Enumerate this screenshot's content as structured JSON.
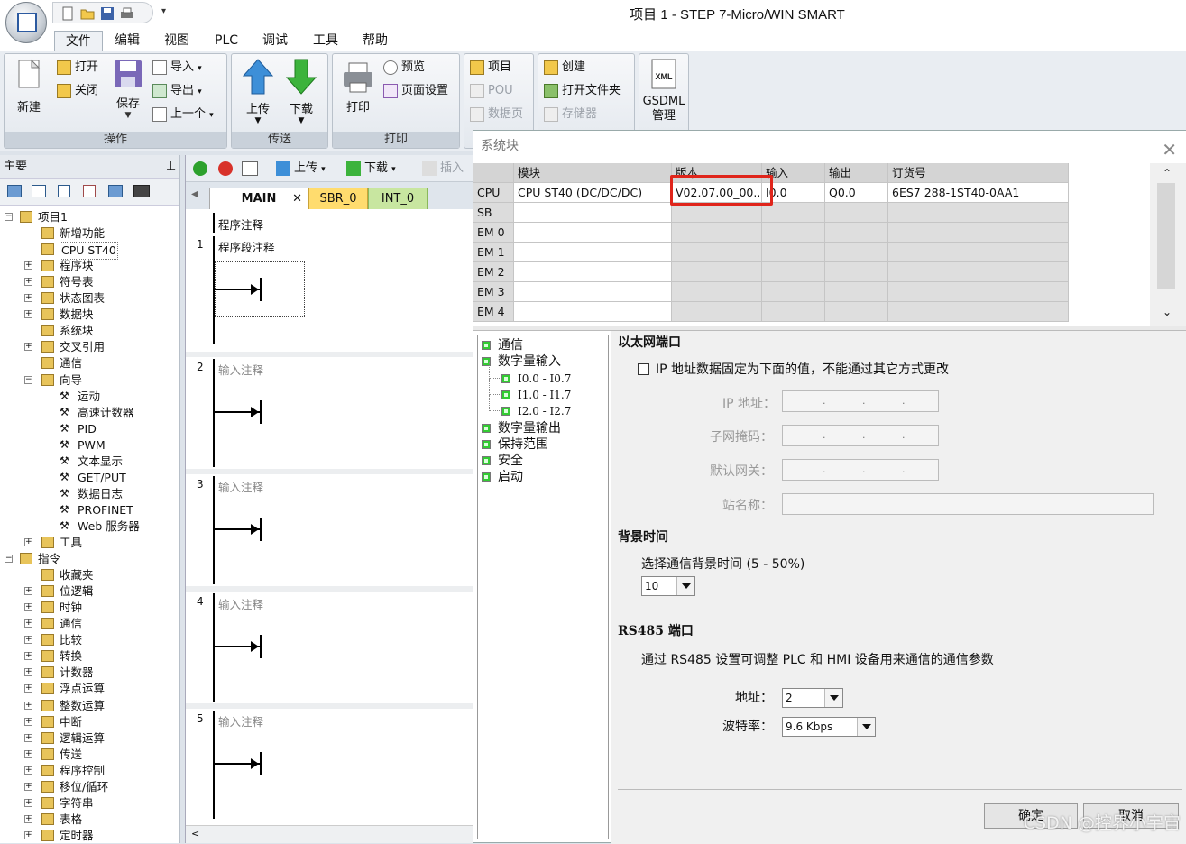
{
  "window": {
    "title": "项目 1 - STEP 7-Micro/WIN SMART"
  },
  "menu_tabs": [
    "文件",
    "编辑",
    "视图",
    "PLC",
    "调试",
    "工具",
    "帮助"
  ],
  "ribbon": {
    "groups": {
      "operate": "操作",
      "transfer": "传送",
      "print": "打印"
    },
    "new": "新建",
    "open": "打开",
    "close": "关闭",
    "save": "保存",
    "import": "导入",
    "export": "导出",
    "prev": "上一个",
    "upload": "上传",
    "download": "下载",
    "print": "打印",
    "preview": "预览",
    "page_setup": "页面设置",
    "project": "项目",
    "pou": "POU",
    "datapage": "数据页",
    "create": "创建",
    "open_folder": "打开文件夹",
    "memory": "存储器",
    "gsdml": "GSDML",
    "gsdml_manage": "管理"
  },
  "left_panel": {
    "title": "主要",
    "tree": [
      {
        "label": "项目1",
        "level": 0,
        "expander": "-"
      },
      {
        "label": "新增功能",
        "level": 1,
        "expander": ""
      },
      {
        "label": "CPU ST40",
        "level": 1,
        "expander": ""
      },
      {
        "label": "程序块",
        "level": 1,
        "expander": "+"
      },
      {
        "label": "符号表",
        "level": 1,
        "expander": "+"
      },
      {
        "label": "状态图表",
        "level": 1,
        "expander": "+"
      },
      {
        "label": "数据块",
        "level": 1,
        "expander": "+"
      },
      {
        "label": "系统块",
        "level": 1,
        "expander": ""
      },
      {
        "label": "交叉引用",
        "level": 1,
        "expander": "+"
      },
      {
        "label": "通信",
        "level": 1,
        "expander": ""
      },
      {
        "label": "向导",
        "level": 1,
        "expander": "-"
      },
      {
        "label": "运动",
        "level": 2,
        "expander": ""
      },
      {
        "label": "高速计数器",
        "level": 2,
        "expander": ""
      },
      {
        "label": "PID",
        "level": 2,
        "expander": ""
      },
      {
        "label": "PWM",
        "level": 2,
        "expander": ""
      },
      {
        "label": "文本显示",
        "level": 2,
        "expander": ""
      },
      {
        "label": "GET/PUT",
        "level": 2,
        "expander": ""
      },
      {
        "label": "数据日志",
        "level": 2,
        "expander": ""
      },
      {
        "label": "PROFINET",
        "level": 2,
        "expander": ""
      },
      {
        "label": "Web 服务器",
        "level": 2,
        "expander": ""
      },
      {
        "label": "工具",
        "level": 1,
        "expander": "+"
      },
      {
        "label": "指令",
        "level": 0,
        "expander": "-"
      },
      {
        "label": "收藏夹",
        "level": 1,
        "expander": ""
      },
      {
        "label": "位逻辑",
        "level": 1,
        "expander": "+"
      },
      {
        "label": "时钟",
        "level": 1,
        "expander": "+"
      },
      {
        "label": "通信",
        "level": 1,
        "expander": "+"
      },
      {
        "label": "比较",
        "level": 1,
        "expander": "+"
      },
      {
        "label": "转换",
        "level": 1,
        "expander": "+"
      },
      {
        "label": "计数器",
        "level": 1,
        "expander": "+"
      },
      {
        "label": "浮点运算",
        "level": 1,
        "expander": "+"
      },
      {
        "label": "整数运算",
        "level": 1,
        "expander": "+"
      },
      {
        "label": "中断",
        "level": 1,
        "expander": "+"
      },
      {
        "label": "逻辑运算",
        "level": 1,
        "expander": "+"
      },
      {
        "label": "传送",
        "level": 1,
        "expander": "+"
      },
      {
        "label": "程序控制",
        "level": 1,
        "expander": "+"
      },
      {
        "label": "移位/循环",
        "level": 1,
        "expander": "+"
      },
      {
        "label": "字符串",
        "level": 1,
        "expander": "+"
      },
      {
        "label": "表格",
        "level": 1,
        "expander": "+"
      },
      {
        "label": "定时器",
        "level": 1,
        "expander": "+"
      }
    ]
  },
  "editor": {
    "toolbar": {
      "upload": "上传",
      "download": "下载",
      "insert": "插入"
    },
    "tabs": [
      "MAIN",
      "SBR_0",
      "INT_0"
    ],
    "program_comment": "程序注释",
    "networks": [
      {
        "num": "1",
        "comment": "程序段注释"
      },
      {
        "num": "2",
        "comment": "输入注释"
      },
      {
        "num": "3",
        "comment": "输入注释"
      },
      {
        "num": "4",
        "comment": "输入注释"
      },
      {
        "num": "5",
        "comment": "输入注释"
      }
    ]
  },
  "dialog": {
    "title": "系统块",
    "grid_headers": [
      "",
      "模块",
      "版本",
      "输入",
      "输出",
      "订货号"
    ],
    "rows": [
      {
        "slot": "CPU",
        "module": "CPU ST40 (DC/DC/DC)",
        "version": "V02.07.00_00....",
        "input": "I0.0",
        "output": "Q0.0",
        "order": "6ES7 288-1ST40-0AA1"
      },
      {
        "slot": "SB",
        "module": "",
        "version": "",
        "input": "",
        "output": "",
        "order": ""
      },
      {
        "slot": "EM 0",
        "module": "",
        "version": "",
        "input": "",
        "output": "",
        "order": ""
      },
      {
        "slot": "EM 1",
        "module": "",
        "version": "",
        "input": "",
        "output": "",
        "order": ""
      },
      {
        "slot": "EM 2",
        "module": "",
        "version": "",
        "input": "",
        "output": "",
        "order": ""
      },
      {
        "slot": "EM 3",
        "module": "",
        "version": "",
        "input": "",
        "output": "",
        "order": ""
      },
      {
        "slot": "EM 4",
        "module": "",
        "version": "",
        "input": "",
        "output": "",
        "order": ""
      }
    ],
    "nav": [
      {
        "label": "通信",
        "level": 0
      },
      {
        "label": "数字量输入",
        "level": 0
      },
      {
        "label": "I0.0 - I0.7",
        "level": 1
      },
      {
        "label": "I1.0 - I1.7",
        "level": 1
      },
      {
        "label": "I2.0 - I2.7",
        "level": 1
      },
      {
        "label": "数字量输出",
        "level": 0
      },
      {
        "label": "保持范围",
        "level": 0
      },
      {
        "label": "安全",
        "level": 0
      },
      {
        "label": "启动",
        "level": 0
      }
    ],
    "ethernet": {
      "heading": "以太网端口",
      "fixed_ip_label": "IP 地址数据固定为下面的值，不能通过其它方式更改",
      "ip_label": "IP 地址：",
      "subnet_label": "子网掩码：",
      "gateway_label": "默认网关：",
      "station_label": "站名称："
    },
    "background": {
      "heading": "背景时间",
      "label": "选择通信背景时间 (5 - 50%)",
      "value": "10"
    },
    "rs485": {
      "heading": "RS485  端口",
      "desc": "通过 RS485 设置可调整 PLC 和 HMI 设备用来通信的通信参数",
      "address_label": "地址：",
      "address_value": "2",
      "baud_label": "波特率：",
      "baud_value": "9.6 Kbps"
    },
    "ok": "确定",
    "cancel": "取消"
  },
  "watermark": "CSDN @控界小宇宙"
}
